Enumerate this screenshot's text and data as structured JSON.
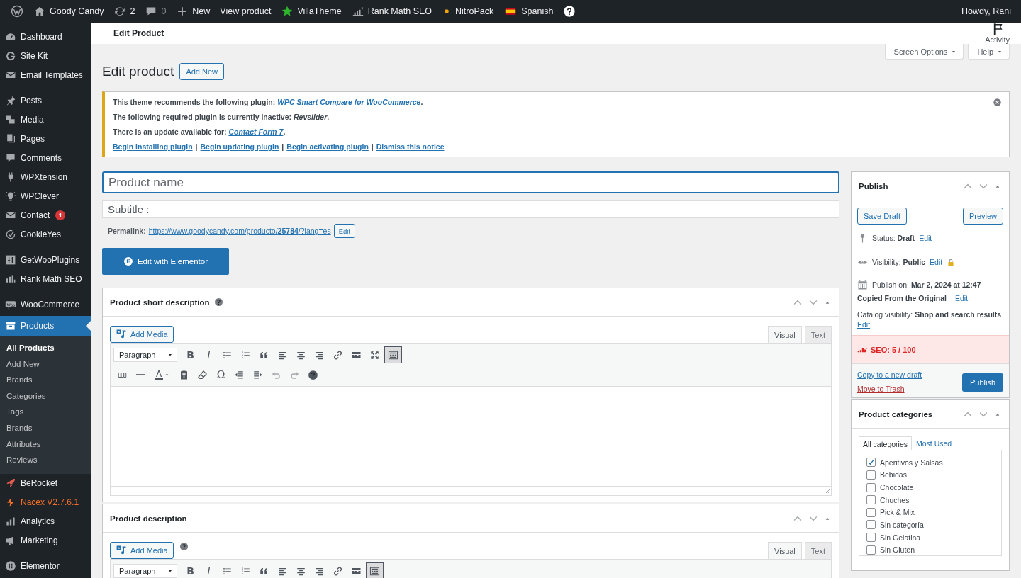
{
  "admin_bar": {
    "items": [
      {
        "kind": "wordpress"
      },
      {
        "kind": "home",
        "label": "Goody Candy"
      },
      {
        "kind": "updates",
        "label": "2"
      },
      {
        "kind": "comments",
        "label": "0"
      },
      {
        "kind": "new",
        "label": "New"
      },
      {
        "kind": "plain",
        "label": "View product"
      },
      {
        "kind": "star",
        "label": "VillaTheme"
      },
      {
        "kind": "rankmath",
        "label": "Rank Math SEO"
      },
      {
        "kind": "dot",
        "label": "NitroPack"
      },
      {
        "kind": "flag",
        "label": "Spanish"
      },
      {
        "kind": "help"
      }
    ],
    "account": "Howdy, Rani"
  },
  "sidebar": {
    "sections": [
      {
        "items": [
          {
            "label": "Dashboard",
            "kind": "menu",
            "selected": false
          },
          {
            "label": "Site Kit",
            "kind": "menu",
            "selected": false
          },
          {
            "label": "Email Templates",
            "kind": "menu",
            "selected": false
          }
        ]
      },
      {
        "items": [
          {
            "label": "Posts",
            "kind": "menu",
            "selected": false
          },
          {
            "label": "Media",
            "kind": "menu",
            "selected": false
          },
          {
            "label": "Pages",
            "kind": "menu",
            "selected": false
          },
          {
            "label": "Comments",
            "kind": "menu",
            "selected": false
          },
          {
            "label": "WPXtension",
            "kind": "menu",
            "selected": false
          },
          {
            "label": "WPClever",
            "kind": "menu",
            "selected": false
          },
          {
            "label": "Contact",
            "kind": "menu",
            "selected": false,
            "badge": "1"
          },
          {
            "label": "CookieYes",
            "kind": "menu",
            "selected": false
          }
        ]
      },
      {
        "items": [
          {
            "label": "GetWooPlugins",
            "kind": "menu",
            "selected": false
          },
          {
            "label": "Rank Math SEO",
            "kind": "menu",
            "selected": false
          }
        ]
      },
      {
        "items": [
          {
            "label": "WooCommerce",
            "kind": "menu",
            "selected": false
          },
          {
            "label": "Products",
            "kind": "menu",
            "selected": true,
            "children": [
              {
                "label": "All Products",
                "selected": true
              },
              {
                "label": "Add New",
                "selected": false
              },
              {
                "label": "Brands",
                "selected": false
              },
              {
                "label": "Categories",
                "selected": false
              },
              {
                "label": "Tags",
                "selected": false
              },
              {
                "label": "Brands",
                "selected": false
              },
              {
                "label": "Attributes",
                "selected": false
              },
              {
                "label": "Reviews",
                "selected": false
              }
            ]
          },
          {
            "label": "BeRocket",
            "kind": "menu",
            "selected": false
          },
          {
            "label": "Nacex V2.7.6.1",
            "kind": "accent",
            "selected": false
          },
          {
            "label": "Analytics",
            "kind": "menu",
            "selected": false
          },
          {
            "label": "Marketing",
            "kind": "menu",
            "selected": false
          }
        ]
      },
      {
        "items": [
          {
            "label": "Elementor",
            "kind": "menu",
            "selected": false
          }
        ]
      }
    ]
  },
  "header": {
    "title": "Edit Product",
    "activity": "Activity"
  },
  "screen_tabs": [
    "Screen Options",
    "Help"
  ],
  "page_title": "Edit product",
  "add_new": "Add New",
  "notice": {
    "lines": [
      {
        "kind": "link",
        "before": "This theme recommends the following plugin: ",
        "link": "WPC Smart Compare for WooCommerce",
        "after": "."
      },
      {
        "kind": "text",
        "text": "The following required plugin is currently inactive: *Revslider*."
      },
      {
        "kind": "link",
        "before": "There is an update available for: ",
        "link": "Contact Form 7",
        "after": "."
      }
    ],
    "actions": [
      {
        "kind": "link",
        "text": "Begin installing plugin"
      },
      {
        "kind": "sep",
        "text": "|"
      },
      {
        "kind": "link",
        "text": "Begin updating plugin"
      },
      {
        "kind": "sep",
        "text": "|"
      },
      {
        "kind": "link",
        "text": "Begin activating plugin"
      },
      {
        "kind": "sep",
        "text": "|"
      },
      {
        "kind": "link",
        "text": "Dismiss this notice"
      }
    ]
  },
  "title_field": {
    "placeholder": "Product name"
  },
  "subtitle_field": {
    "placeholder": "Subtitle :"
  },
  "permalink": {
    "label": "Permalink:",
    "url": "https://www.goodycandy.com/producto/**25784**/?lang=es",
    "edit": "Edit"
  },
  "elementor_button": "Edit with Elementor",
  "editors": [
    {
      "title": "Product short description",
      "add_media": "Add Media",
      "tabs": [
        {
          "label": "Visual",
          "selected": true
        },
        {
          "label": "Text",
          "selected": false
        }
      ],
      "toolbar": [
        [
          {
            "kind": "select",
            "value": "Paragraph"
          },
          {
            "kind": "glyph",
            "text": "B",
            "pressed": false
          },
          {
            "kind": "glyph",
            "text": "I",
            "pressed": false
          },
          {
            "kind": "bullets",
            "pressed": false
          },
          {
            "kind": "numbers",
            "pressed": false
          },
          {
            "kind": "quote",
            "pressed": false
          },
          {
            "kind": "alignleft",
            "pressed": false
          },
          {
            "kind": "aligncenter",
            "pressed": false
          },
          {
            "kind": "alignright",
            "pressed": false
          },
          {
            "kind": "link",
            "pressed": false
          },
          {
            "kind": "more",
            "pressed": false
          },
          {
            "kind": "fullscreen",
            "pressed": false
          },
          {
            "kind": "toolbar",
            "pressed": true
          }
        ],
        [
          {
            "kind": "strike",
            "disabled": false
          },
          {
            "kind": "rule",
            "disabled": false
          },
          {
            "kind": "textcolor",
            "text": "A",
            "disabled": false
          },
          {
            "kind": "paste",
            "disabled": false
          },
          {
            "kind": "eraser",
            "disabled": false
          },
          {
            "kind": "glyph",
            "text": "Ω",
            "disabled": false
          },
          {
            "kind": "outdent",
            "disabled": false
          },
          {
            "kind": "indent",
            "disabled": false
          },
          {
            "kind": "undo",
            "disabled": true
          },
          {
            "kind": "redo",
            "disabled": true
          },
          {
            "kind": "help",
            "disabled": false
          }
        ]
      ]
    },
    {
      "title": "Product description",
      "add_media": "Add Media",
      "tabs": [
        {
          "label": "Visual",
          "selected": true
        },
        {
          "label": "Text",
          "selected": false
        }
      ],
      "toolbar": [
        [
          {
            "kind": "select",
            "value": "Paragraph"
          },
          {
            "kind": "glyph",
            "text": "B",
            "pressed": false
          },
          {
            "kind": "glyph",
            "text": "I",
            "pressed": false
          },
          {
            "kind": "bullets",
            "pressed": false
          },
          {
            "kind": "numbers",
            "pressed": false
          },
          {
            "kind": "quote",
            "pressed": false
          },
          {
            "kind": "alignleft",
            "pressed": false
          },
          {
            "kind": "aligncenter",
            "pressed": false
          },
          {
            "kind": "alignright",
            "pressed": false
          },
          {
            "kind": "link",
            "pressed": false
          },
          {
            "kind": "more",
            "pressed": false
          },
          {
            "kind": "toolbar",
            "pressed": true
          }
        ]
      ]
    }
  ],
  "publish": {
    "title": "Publish",
    "save_draft": "Save Draft",
    "preview": "Preview",
    "status": {
      "text": "Status: **Draft**",
      "link": "Edit"
    },
    "visibility": {
      "text": "Visibility: **Public**",
      "link": "Edit"
    },
    "schedule": "Publish on: **Mar 2, 2024 at 12:47**",
    "copied": {
      "text": "Copied From the Original",
      "link": "Edit"
    },
    "catalog": {
      "text": "Catalog visibility: **Shop and search results**",
      "link": "Edit"
    },
    "seo": "SEO: 5 / 100",
    "copy_link": "Copy to a new draft",
    "trash_link": "Move to Trash",
    "publish_button": "Publish"
  },
  "categories": {
    "title": "Product categories",
    "tabs": [
      {
        "label": "All categories",
        "selected": true
      },
      {
        "label": "Most Used",
        "selected": false
      }
    ],
    "items": [
      {
        "label": "Aperitivos y Salsas",
        "checked": true
      },
      {
        "label": "Bebidas",
        "checked": false
      },
      {
        "label": "Chocolate",
        "checked": false
      },
      {
        "label": "Chuches",
        "checked": false
      },
      {
        "label": "Pick & Mix",
        "checked": false
      },
      {
        "label": "Sin categoría",
        "checked": false
      },
      {
        "label": "Sin Gelatina",
        "checked": false
      },
      {
        "label": "Sin Gluten",
        "checked": false
      }
    ]
  }
}
